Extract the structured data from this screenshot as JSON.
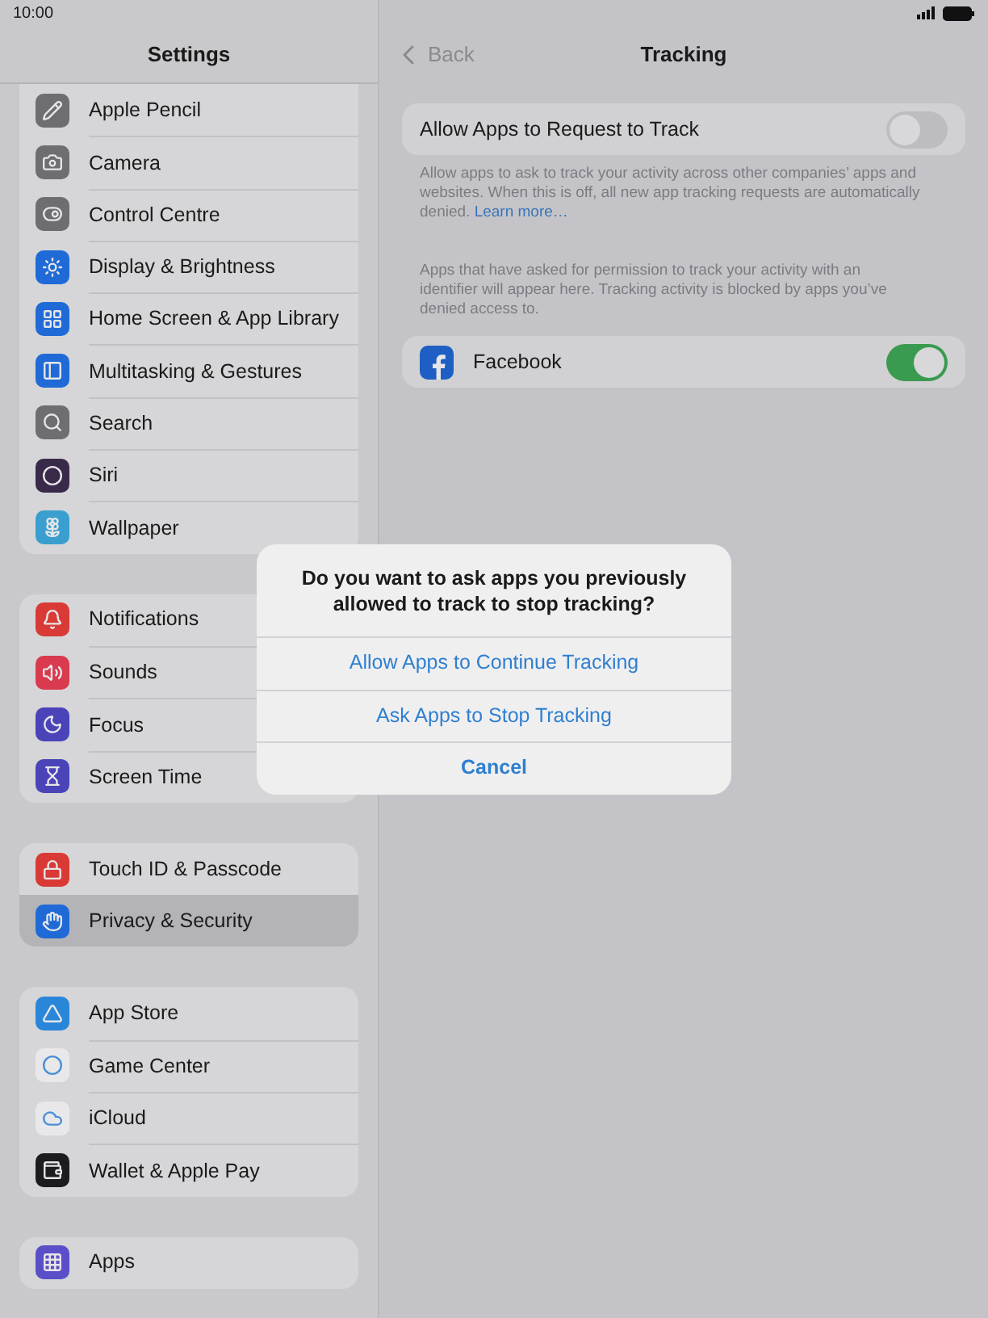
{
  "status_bar": {
    "time": "10:00"
  },
  "sidebar": {
    "title": "Settings",
    "groups": [
      {
        "items": [
          {
            "label": "Apple Pencil",
            "color": "#6e6e72",
            "selected": false
          },
          {
            "label": "Camera",
            "color": "#6e6e72",
            "selected": false
          },
          {
            "label": "Control Centre",
            "color": "#6e6e72",
            "selected": false
          },
          {
            "label": "Display & Brightness",
            "color": "#1f6ad6",
            "selected": false
          },
          {
            "label": "Home Screen & App Library",
            "color": "#1f6ad6",
            "selected": false
          },
          {
            "label": "Multitasking & Gestures",
            "color": "#1f6ad6",
            "selected": false
          },
          {
            "label": "Search",
            "color": "#6e6e72",
            "selected": false
          },
          {
            "label": "Siri",
            "color": "#3a2a4a",
            "selected": false
          },
          {
            "label": "Wallpaper",
            "color": "#3a9fcf",
            "selected": false
          }
        ]
      },
      {
        "items": [
          {
            "label": "Notifications",
            "color": "#d93a36",
            "selected": false
          },
          {
            "label": "Sounds",
            "color": "#d93a4e",
            "selected": false
          },
          {
            "label": "Focus",
            "color": "#4b44b8",
            "selected": false
          },
          {
            "label": "Screen Time",
            "color": "#4b44b8",
            "selected": false
          }
        ]
      },
      {
        "items": [
          {
            "label": "Touch ID & Passcode",
            "color": "#d93a36",
            "selected": false
          },
          {
            "label": "Privacy & Security",
            "color": "#1f6ad6",
            "selected": true
          }
        ]
      },
      {
        "items": [
          {
            "label": "App Store",
            "color": "#2a86d9",
            "selected": false
          },
          {
            "label": "Game Center",
            "color": "#e8e8ea",
            "selected": false
          },
          {
            "label": "iCloud",
            "color": "#e8e8ea",
            "selected": false
          },
          {
            "label": "Wallet & Apple Pay",
            "color": "#1c1c1e",
            "selected": false
          }
        ]
      },
      {
        "items": [
          {
            "label": "Apps",
            "color": "#5a4fc8",
            "selected": false
          }
        ]
      }
    ]
  },
  "detail": {
    "back": "Back",
    "title": "Tracking",
    "allow_row": {
      "label": "Allow Apps to Request to Track",
      "on": false
    },
    "allow_footer": {
      "text": "Allow apps to ask to track your activity across other companies’ apps and websites. When this is off, all new app tracking requests are automatically denied.",
      "link": "Learn more…"
    },
    "apps_header": "Apps that have asked for permission to track your activity with an identifier will appear here. Tracking activity is blocked by apps you’ve denied access to.",
    "apps": [
      {
        "label": "Facebook",
        "on": true
      }
    ]
  },
  "dialog": {
    "title": "Do you want to ask apps you previously allowed to track to stop tracking?",
    "buttons": [
      {
        "label": "Allow Apps to Continue Tracking",
        "kind": "default"
      },
      {
        "label": "Ask Apps to Stop Tracking",
        "kind": "default"
      },
      {
        "label": "Cancel",
        "kind": "cancel"
      }
    ]
  }
}
